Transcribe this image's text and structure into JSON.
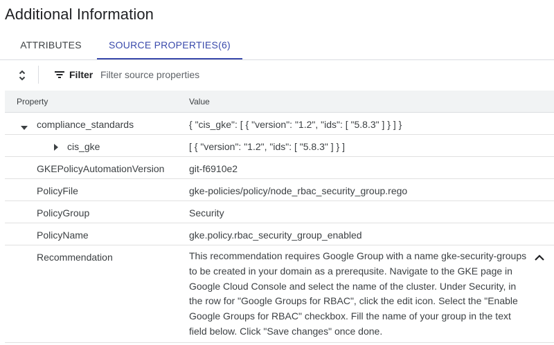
{
  "page": {
    "title": "Additional Information"
  },
  "tabs": [
    {
      "label": "ATTRIBUTES",
      "active": false
    },
    {
      "label": "SOURCE PROPERTIES(6)",
      "active": true
    }
  ],
  "toolbar": {
    "sort_icon": "unfold-more-icon",
    "filter_icon": "filter-list-icon",
    "filter_label": "Filter",
    "filter_placeholder": "Filter source properties",
    "filter_value": ""
  },
  "table": {
    "headers": {
      "property": "Property",
      "value": "Value"
    },
    "rows": [
      {
        "property": "compliance_standards",
        "value": "{ \"cis_gke\": [ { \"version\": \"1.2\", \"ids\": [ \"5.8.3\" ] } ] }",
        "expander": "expanded"
      },
      {
        "property": "cis_gke",
        "value": "[ { \"version\": \"1.2\", \"ids\": [ \"5.8.3\" ] } ]",
        "expander": "collapsed"
      },
      {
        "property": "GKEPolicyAutomationVersion",
        "value": "git-f6910e2"
      },
      {
        "property": "PolicyFile",
        "value": "gke-policies/policy/node_rbac_security_group.rego"
      },
      {
        "property": "PolicyGroup",
        "value": "Security"
      },
      {
        "property": "PolicyName",
        "value": "gke.policy.rbac_security_group_enabled"
      },
      {
        "property": "Recommendation",
        "value": "This recommendation requires Google Group with a name gke-security-groups to be created in your domain as a prerequsite. Navigate to the GKE page in Google Cloud Console and select the name of the cluster. Under Security, in the row for \"Google Groups for RBAC\", click the edit icon. Select the \"Enable Google Groups for RBAC\" checkbox. Fill the name of your group in the text field below. Click \"Save changes\" once done.",
        "expander": "chevron-up"
      }
    ]
  },
  "colors": {
    "accent": "#3949ab",
    "header_bg": "#f1f3f4",
    "border": "#dadce0",
    "text": "#3c4043"
  }
}
